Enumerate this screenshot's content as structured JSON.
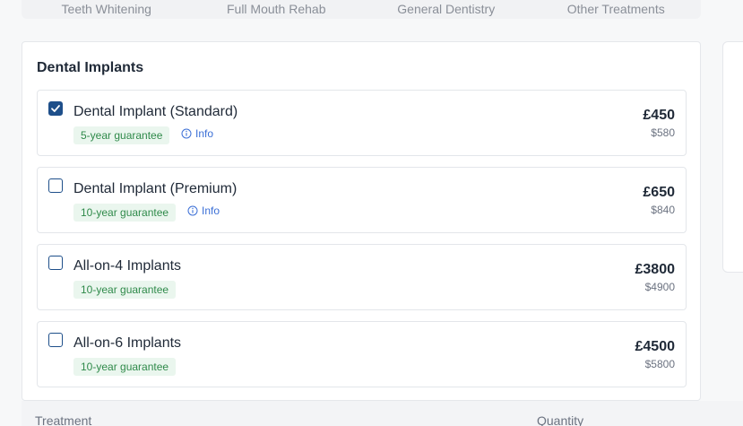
{
  "tabs": [
    "Teeth Whitening",
    "Full Mouth Rehab",
    "General Dentistry",
    "Other Treatments"
  ],
  "section": {
    "title": "Dental Implants"
  },
  "options": [
    {
      "name": "Dental Implant (Standard)",
      "guarantee": "5-year guarantee",
      "info": "Info",
      "gbp": "£450",
      "usd": "$580",
      "checked": true
    },
    {
      "name": "Dental Implant (Premium)",
      "guarantee": "10-year guarantee",
      "info": "Info",
      "gbp": "£650",
      "usd": "$840",
      "checked": false
    },
    {
      "name": "All-on-4 Implants",
      "guarantee": "10-year guarantee",
      "gbp": "£3800",
      "usd": "$4900",
      "checked": false
    },
    {
      "name": "All-on-6 Implants",
      "guarantee": "10-year guarantee",
      "gbp": "£4500",
      "usd": "$5800",
      "checked": false
    }
  ],
  "table": {
    "col_treatment": "Treatment",
    "col_quantity": "Quantity"
  },
  "colors": {
    "accent": "#1e4f8a",
    "badge_bg": "#eaf6ee",
    "badge_text": "#2f8a4a",
    "link": "#3b6fd6"
  }
}
